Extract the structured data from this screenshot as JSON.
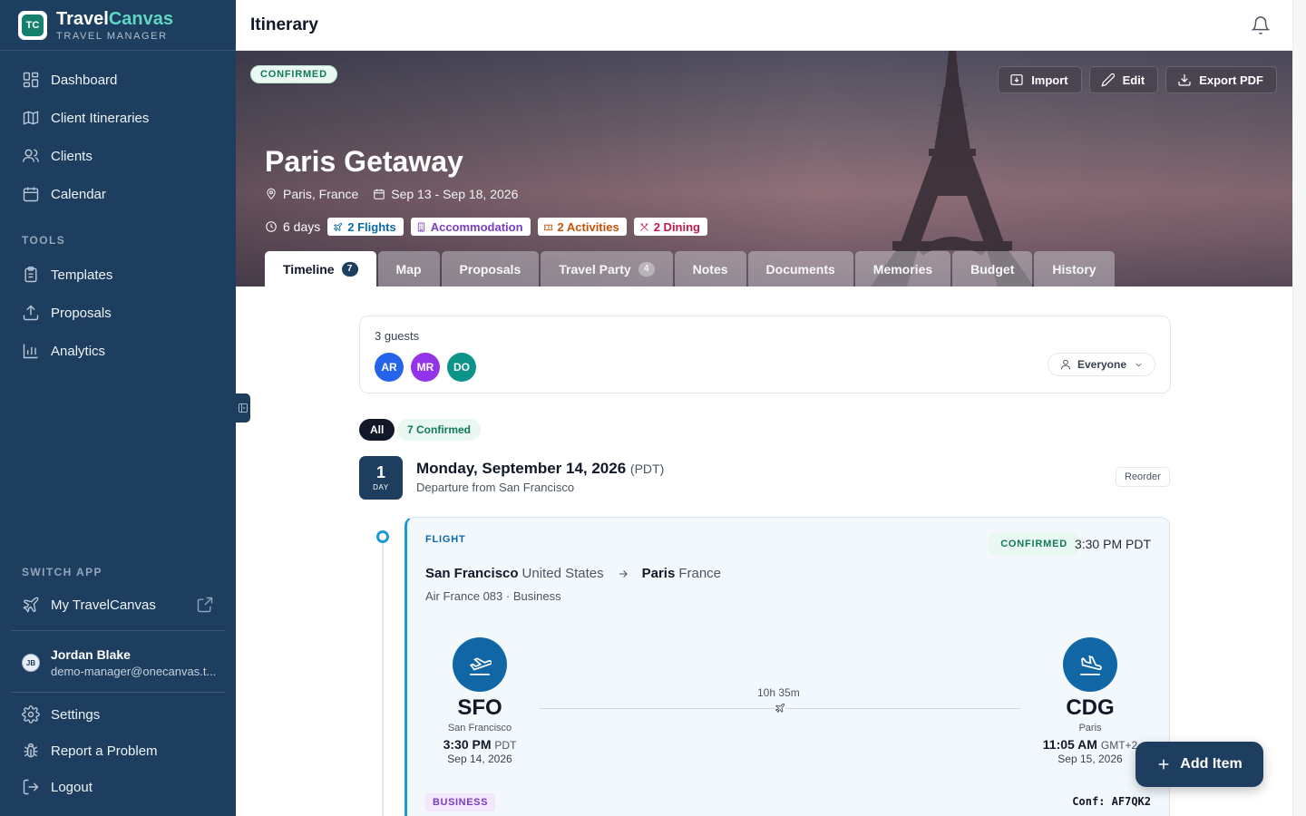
{
  "app": {
    "name_part1": "Travel",
    "name_part2": "Canvas",
    "subtitle": "TRAVEL MANAGER",
    "logo_text": "TC"
  },
  "sidebar": {
    "main_items": [
      {
        "label": "Dashboard",
        "icon": "dashboard-icon"
      },
      {
        "label": "Client Itineraries",
        "icon": "map-icon"
      },
      {
        "label": "Clients",
        "icon": "users-icon"
      },
      {
        "label": "Calendar",
        "icon": "calendar-icon"
      }
    ],
    "tools_label": "TOOLS",
    "tools_items": [
      {
        "label": "Templates",
        "icon": "clipboard-icon"
      },
      {
        "label": "Proposals",
        "icon": "upload-icon"
      },
      {
        "label": "Analytics",
        "icon": "bar-chart-icon"
      }
    ],
    "switch_label": "SWITCH APP",
    "switch_item": {
      "label": "My TravelCanvas",
      "icon": "plane-icon"
    },
    "user": {
      "initials": "JB",
      "name": "Jordan Blake",
      "email": "demo-manager@onecanvas.t..."
    },
    "bottom_items": [
      {
        "label": "Settings",
        "icon": "gear-icon"
      },
      {
        "label": "Report a Problem",
        "icon": "bug-icon"
      },
      {
        "label": "Logout",
        "icon": "logout-icon"
      }
    ]
  },
  "topbar": {
    "title": "Itinerary"
  },
  "hero": {
    "status": "CONFIRMED",
    "actions": {
      "import": "Import",
      "edit": "Edit",
      "export": "Export PDF"
    },
    "title": "Paris Getaway",
    "location": "Paris, France",
    "dates": "Sep 13 - Sep 18, 2026",
    "duration": "6 days",
    "tags": {
      "flights": "2 Flights",
      "accommodation": "Accommodation",
      "activities": "2 Activities",
      "dining": "2 Dining"
    }
  },
  "tabs": [
    {
      "label": "Timeline",
      "count": "7",
      "active": true
    },
    {
      "label": "Map"
    },
    {
      "label": "Proposals"
    },
    {
      "label": "Travel Party",
      "count": "4"
    },
    {
      "label": "Notes"
    },
    {
      "label": "Documents"
    },
    {
      "label": "Memories"
    },
    {
      "label": "Budget"
    },
    {
      "label": "History"
    }
  ],
  "guests": {
    "label": "3 guests",
    "avatars": [
      {
        "initials": "AR",
        "color": "#2563eb"
      },
      {
        "initials": "MR",
        "color": "#9333ea"
      },
      {
        "initials": "DO",
        "color": "#0d9488"
      }
    ],
    "filter": "Everyone"
  },
  "filters": {
    "all": "All",
    "confirmed": "7 Confirmed"
  },
  "day": {
    "number": "1",
    "label": "DAY",
    "date": "Monday, September 14, 2026",
    "tz": "(PDT)",
    "subtitle": "Departure from San Francisco",
    "reorder": "Reorder"
  },
  "flight": {
    "type": "FLIGHT",
    "status": "CONFIRMED",
    "time": "3:30 PM PDT",
    "from_city": "San Francisco",
    "from_country": "United States",
    "to_city": "Paris",
    "to_country": "France",
    "info": "Air France 083 · Business",
    "departure": {
      "code": "SFO",
      "name": "San Francisco",
      "time": "3:30 PM",
      "tz": "PDT",
      "date": "Sep 14, 2026"
    },
    "arrival": {
      "code": "CDG",
      "name": "Paris",
      "time": "11:05 AM",
      "tz": "GMT+2",
      "date": "Sep 15, 2026"
    },
    "duration": "10h 35m",
    "cabin": "BUSINESS",
    "confirmation": "Conf: AF7QK2"
  },
  "fab": {
    "label": "Add Item"
  },
  "colors": {
    "sidebar": "#1d3e5e",
    "accent": "#1a9bd7",
    "brand_teal": "#5fd7c4",
    "confirmed": "#117a5b"
  }
}
